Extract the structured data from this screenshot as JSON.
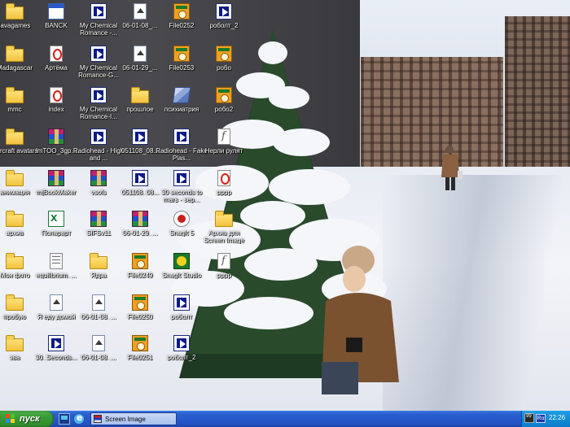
{
  "desktop": {
    "icons": [
      {
        "label": "javagames",
        "icon": "folder-icon",
        "glyph": "folder"
      },
      {
        "label": "Madagascar",
        "icon": "folder-icon",
        "glyph": "folder"
      },
      {
        "label": "mmc",
        "icon": "folder-icon",
        "glyph": "folder"
      },
      {
        "label": "starcraft avatars",
        "icon": "folder-icon",
        "glyph": "folder"
      },
      {
        "label": "анимация",
        "icon": "folder-icon",
        "glyph": "folder"
      },
      {
        "label": "архив",
        "icon": "folder-icon",
        "glyph": "folder"
      },
      {
        "label": "Мои фото",
        "icon": "folder-icon",
        "glyph": "folder"
      },
      {
        "label": "пробую",
        "icon": "folder-icon",
        "glyph": "folder"
      },
      {
        "label": "эва",
        "icon": "folder-icon",
        "glyph": "folder"
      },
      {
        "label": "BANCK",
        "icon": "window-icon",
        "glyph": "window"
      },
      {
        "label": "Артёма",
        "icon": "opera-icon",
        "glyph": "opera"
      },
      {
        "label": "index",
        "icon": "opera-icon",
        "glyph": "opera"
      },
      {
        "label": "lmTOO_3gp...",
        "icon": "winrar-icon",
        "glyph": "rar"
      },
      {
        "label": "mjBookMaker",
        "icon": "winrar-icon",
        "glyph": "rar"
      },
      {
        "label": "Поларарт",
        "icon": "excel-icon",
        "glyph": "excel"
      },
      {
        "label": "equilibrium_...",
        "icon": "text-file-icon",
        "glyph": "text"
      },
      {
        "label": "Я еду домой",
        "icon": "document-icon",
        "glyph": "doc"
      },
      {
        "label": "30_Seconds...",
        "icon": "media-file-icon",
        "glyph": "media"
      },
      {
        "label": "My Chemical Romance -...",
        "icon": "media-file-icon",
        "glyph": "media"
      },
      {
        "label": "My Chemical Romance-G...",
        "icon": "media-file-icon",
        "glyph": "media"
      },
      {
        "label": "My Chemical Romance-I...",
        "icon": "media-file-icon",
        "glyph": "media"
      },
      {
        "label": "Radiohead - High and ...",
        "icon": "media-file-icon",
        "glyph": "media"
      },
      {
        "label": "vsofs",
        "icon": "winrar-icon",
        "glyph": "rar"
      },
      {
        "label": "SIFSv11",
        "icon": "winrar-icon",
        "glyph": "rar"
      },
      {
        "label": "Ядра",
        "icon": "folder-icon",
        "glyph": "folder"
      },
      {
        "label": "06-01-08_...",
        "icon": "document-icon",
        "glyph": "doc"
      },
      {
        "label": "06-01-08_...",
        "icon": "document-icon",
        "glyph": "doc"
      },
      {
        "label": "06-01-08_...",
        "icon": "document-icon",
        "glyph": "doc"
      },
      {
        "label": "06-01-29_...",
        "icon": "document-icon",
        "glyph": "doc"
      },
      {
        "label": "прошлое",
        "icon": "folder-icon",
        "glyph": "folder"
      },
      {
        "label": "051108_08...",
        "icon": "media-file-icon",
        "glyph": "media"
      },
      {
        "label": "051108_08...",
        "icon": "media-file-icon",
        "glyph": "media"
      },
      {
        "label": "06-01-29_...",
        "icon": "winrar-icon",
        "glyph": "rar"
      },
      {
        "label": "File0249",
        "icon": "image-file-icon",
        "glyph": "image"
      },
      {
        "label": "File0250",
        "icon": "image-file-icon",
        "glyph": "image"
      },
      {
        "label": "File0251",
        "icon": "image-file-icon",
        "glyph": "image"
      },
      {
        "label": "File0252",
        "icon": "image-file-icon",
        "glyph": "image"
      },
      {
        "label": "File0253",
        "icon": "image-file-icon",
        "glyph": "image"
      },
      {
        "label": "психиатрия",
        "icon": "stack-icon",
        "glyph": "stack"
      },
      {
        "label": "Radiohead - Fake Plas...",
        "icon": "media-file-icon",
        "glyph": "media"
      },
      {
        "label": "30 seconds to mars - sep...",
        "icon": "media-file-icon",
        "glyph": "media"
      },
      {
        "label": "SnagIt 5",
        "icon": "snagit-icon",
        "glyph": "snagit"
      },
      {
        "label": "SnagIt Studio",
        "icon": "snagit-studio-icon",
        "glyph": "snagit-studio"
      },
      {
        "label": "роболт",
        "icon": "media-file-icon",
        "glyph": "media"
      },
      {
        "label": "роболт_2",
        "icon": "media-file-icon",
        "glyph": "media"
      },
      {
        "label": "роболт_2",
        "icon": "media-file-icon",
        "glyph": "media"
      },
      {
        "label": "робо",
        "icon": "image-file-icon",
        "glyph": "image"
      },
      {
        "label": "робо2",
        "icon": "image-file-icon",
        "glyph": "image"
      },
      {
        "label": "Нерли рулят",
        "icon": "flash-file-icon",
        "glyph": "flash"
      },
      {
        "label": "рррр",
        "icon": "opera-icon",
        "glyph": "opera"
      },
      {
        "label": "Архив для Screen Image",
        "icon": "folder-icon",
        "glyph": "folder"
      },
      {
        "label": "рррр",
        "icon": "flash-file-icon",
        "glyph": "flash"
      }
    ]
  },
  "taskbar": {
    "start_label": "пуск",
    "quick_launch": [
      {
        "icon": "show-desktop-icon"
      },
      {
        "icon": "internet-explorer-icon"
      }
    ],
    "tasks": [
      {
        "label": "Screen Image",
        "icon": "screen-image-app-icon"
      }
    ],
    "tray": {
      "badge": "99",
      "language": "Ru",
      "clock": "22:26"
    }
  },
  "colors": {
    "taskbar_blue": "#2452c2",
    "start_green": "#3a9a36",
    "tray_blue": "#1290d8"
  }
}
